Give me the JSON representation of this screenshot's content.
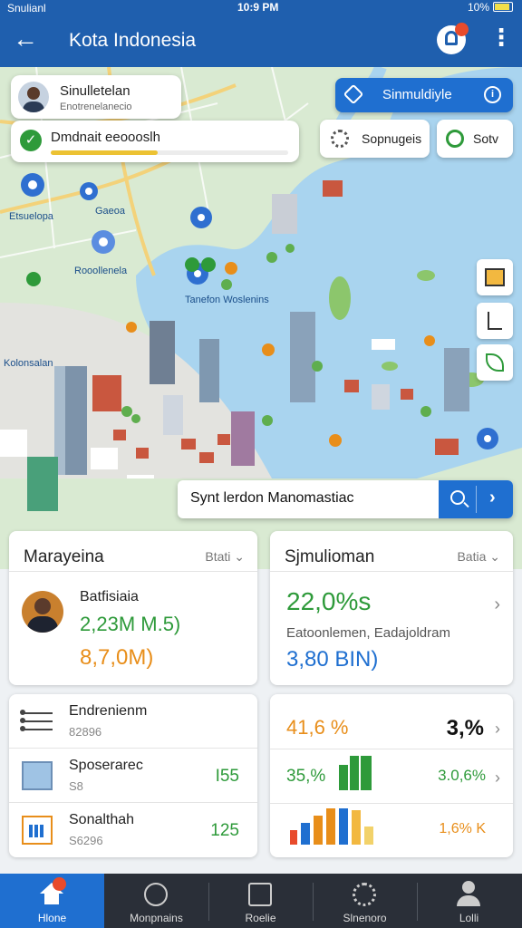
{
  "status_bar": {
    "carrier": "Snulianl",
    "time": "10:9 PM",
    "battery": "10%"
  },
  "app_bar": {
    "title": "Kota Indonesia",
    "icons": [
      "back-arrow-icon",
      "bell-icon",
      "more-vert-icon"
    ]
  },
  "map": {
    "profile": {
      "name": "Sinulletelan",
      "subtitle": "Enotrenelanecio"
    },
    "progress": {
      "label": "Dmdnait eeoooslh",
      "fraction": 0.45
    },
    "simulate_button": {
      "label": "Sinmuldiyle"
    },
    "settings_chip": {
      "label": "Sopnugeis"
    },
    "save_chip": {
      "label": "Sotv"
    },
    "labels": [
      "Etsuelopa",
      "Gaeoa",
      "Rooollenela",
      "Tanefon Woslenins",
      "Kolonsalan"
    ],
    "search": {
      "text": "Synt lerdon Manomastiac"
    },
    "colors": {
      "water": "#a9d4ef",
      "land": "#d9ead2",
      "accent": "#1f6fd0"
    }
  },
  "cards": {
    "management": {
      "title": "Marayeina",
      "dropdown": "Btati",
      "person": "Batfisiaia",
      "value1": "2,23M M.5)",
      "value2": "8,7,0M)"
    },
    "simulation": {
      "title": "Sjmulioman",
      "dropdown": "Batia",
      "big_value": "22,0%s",
      "description": "Eatoonlemen, Eadajoldram",
      "value": "3,80 BIN)"
    },
    "list": [
      {
        "title": "Endrenienm",
        "sub": "82896",
        "value": ""
      },
      {
        "title": "Sposerarec",
        "sub": "S8",
        "value": "I55"
      },
      {
        "title": "Sonalthah",
        "sub": "S6296",
        "value": "125"
      }
    ],
    "stats": {
      "row1_left": "41,6 %",
      "row1_right": "3,%",
      "row2_left": "35,%",
      "row2_right": "3.0,6%",
      "row3_right": "1,6% K"
    }
  },
  "bottom_nav": [
    {
      "label": "Hlone",
      "icon": "home-icon"
    },
    {
      "label": "Monpnains",
      "icon": "compass-icon"
    },
    {
      "label": "Roelie",
      "icon": "route-icon"
    },
    {
      "label": "Slnenoro",
      "icon": "gear-icon"
    },
    {
      "label": "Lolli",
      "icon": "person-icon"
    }
  ]
}
